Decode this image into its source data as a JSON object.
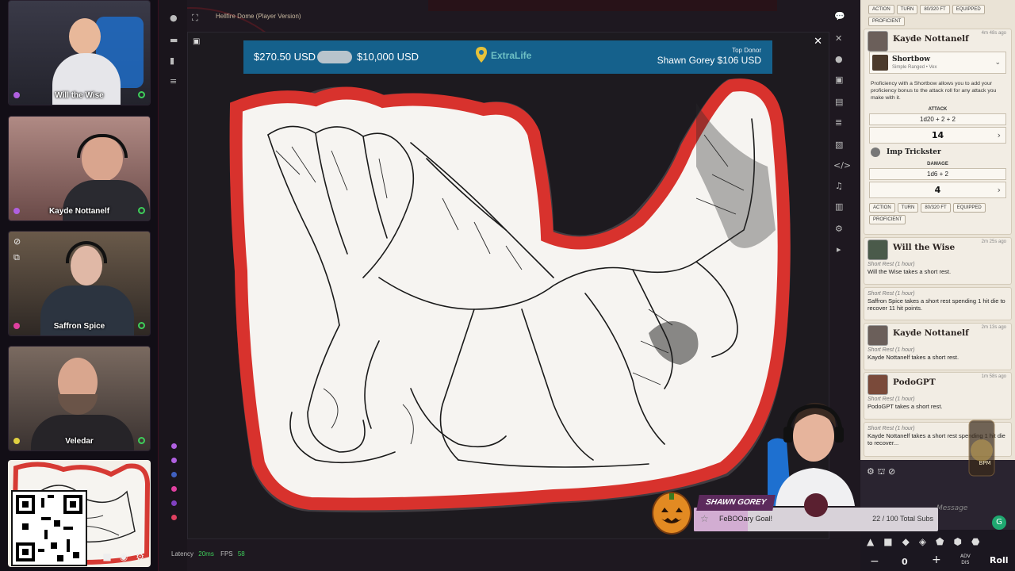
{
  "cams": [
    {
      "name": "Will the Wise",
      "dot": "#b060e0",
      "bg": "#3a3a48",
      "skin": "#e8b89a",
      "shirt": "#e6e6ea"
    },
    {
      "name": "Kayde Nottanelf",
      "dot": "#b060e0",
      "bg": "#8a6260",
      "skin": "#d9a58e",
      "shirt": "#2a2a30"
    },
    {
      "name": "Saffron Spice",
      "dot": "#e040a0",
      "bg": "#5a4a40",
      "skin": "#e0b8a6",
      "shirt": "#2c3440"
    },
    {
      "name": "Veledar",
      "dot": "#e0d040",
      "bg": "#5e5450",
      "skin": "#d9a68e",
      "shirt": "#262428"
    }
  ],
  "vtt": {
    "title": "Hellfire Dome (Player Version)",
    "latency_label": "Latency",
    "latency_value": "20ms",
    "fps_label": "FPS",
    "fps_value": "58"
  },
  "donation": {
    "raised": "$270.50 USD",
    "goal": "$10,000 USD",
    "brand": "ExtraLife",
    "top_donor_label": "Top Donor",
    "top_donor": "Shawn Gorey $106 USD"
  },
  "chat": {
    "tags_top": [
      "ACTION",
      "TURN",
      "80/320 FT",
      "EQUIPPED",
      "PROFICIENT"
    ],
    "attack_msg": {
      "name": "Kayde Nottanelf",
      "time": "4m 48s ago",
      "weapon": "Shortbow",
      "weapon_sub": "Simple Ranged • Vex",
      "desc": "Proficiency with a Shortbow allows you to add your proficiency bonus to the attack roll for any attack you make with it.",
      "attack_label": "ATTACK",
      "attack_formula": "1d20 + 2 + 2",
      "attack_result": "14",
      "feature": "Imp Trickster",
      "damage_label": "DAMAGE",
      "damage_formula": "1d6 + 2",
      "damage_result": "4"
    },
    "tags_bottom": [
      "ACTION",
      "TURN",
      "80/320 FT",
      "EQUIPPED",
      "PROFICIENT"
    ],
    "rest1": {
      "name": "Will the Wise",
      "time": "2m 25s ago",
      "flavor": "Short Rest (1 hour)",
      "text": "Will the Wise takes a short rest."
    },
    "rest2": {
      "flavor": "Short Rest (1 hour)",
      "text": "Saffron Spice takes a short rest spending 1 hit die to recover 11 hit points."
    },
    "rest3": {
      "name": "Kayde Nottanelf",
      "time": "2m 13s ago",
      "flavor": "Short Rest (1 hour)",
      "text": "Kayde Nottanelf takes a short rest."
    },
    "rest4": {
      "name": "PodoGPT",
      "time": "1m 58s ago",
      "flavor": "Short Rest (1 hour)",
      "text": "PodoGPT takes a short rest."
    },
    "rest5": {
      "flavor": "Short Rest (1 hour)",
      "text": "Kayde Nottanelf takes a short rest spending 1 hit die to recover..."
    },
    "message_placeholder": "Message"
  },
  "toolbar": {
    "dice_count": "0",
    "adv_label": "ADV\nDIS",
    "roll_label": "Roll",
    "minus": "−",
    "plus": "+"
  },
  "alert": {
    "name": "SHAWN GOREY",
    "goal": "FeBOOary Goal!",
    "count": "22 / 100 Total Subs",
    "progress": 0.22
  },
  "bpm": "BPM"
}
